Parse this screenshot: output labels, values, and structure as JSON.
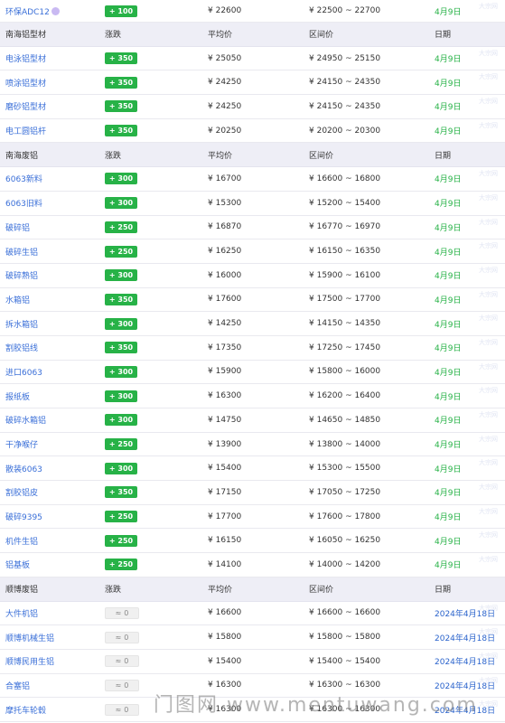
{
  "rows": [
    {
      "type": "item",
      "name": "环保ADC12",
      "tag": true,
      "change": "+ 100",
      "avg": "¥ 22600",
      "range": "¥ 22500 ~ 22700",
      "date": "4月9日",
      "date_color": "green",
      "first": true
    },
    {
      "type": "header",
      "name": "南海铝型材",
      "change": "涨跌",
      "avg": "平均价",
      "range": "区间价",
      "date": "日期"
    },
    {
      "type": "item",
      "name": "电泳铝型材",
      "change": "+ 350",
      "avg": "¥ 25050",
      "range": "¥ 24950 ~ 25150",
      "date": "4月9日",
      "date_color": "green"
    },
    {
      "type": "item",
      "name": "喷涂铝型材",
      "change": "+ 350",
      "avg": "¥ 24250",
      "range": "¥ 24150 ~ 24350",
      "date": "4月9日",
      "date_color": "green"
    },
    {
      "type": "item",
      "name": "磨砂铝型材",
      "change": "+ 350",
      "avg": "¥ 24250",
      "range": "¥ 24150 ~ 24350",
      "date": "4月9日",
      "date_color": "green"
    },
    {
      "type": "item",
      "name": "电工圆铝杆",
      "change": "+ 350",
      "avg": "¥ 20250",
      "range": "¥ 20200 ~ 20300",
      "date": "4月9日",
      "date_color": "green"
    },
    {
      "type": "header",
      "name": "南海废铝",
      "change": "涨跌",
      "avg": "平均价",
      "range": "区间价",
      "date": "日期"
    },
    {
      "type": "item",
      "name": "6063新料",
      "change": "+ 300",
      "avg": "¥ 16700",
      "range": "¥ 16600 ~ 16800",
      "date": "4月9日",
      "date_color": "green"
    },
    {
      "type": "item",
      "name": "6063旧料",
      "change": "+ 300",
      "avg": "¥ 15300",
      "range": "¥ 15200 ~ 15400",
      "date": "4月9日",
      "date_color": "green"
    },
    {
      "type": "item",
      "name": "破碎铝",
      "change": "+ 250",
      "avg": "¥ 16870",
      "range": "¥ 16770 ~ 16970",
      "date": "4月9日",
      "date_color": "green"
    },
    {
      "type": "item",
      "name": "破碎生铝",
      "change": "+ 250",
      "avg": "¥ 16250",
      "range": "¥ 16150 ~ 16350",
      "date": "4月9日",
      "date_color": "green"
    },
    {
      "type": "item",
      "name": "破碎熟铝",
      "change": "+ 300",
      "avg": "¥ 16000",
      "range": "¥ 15900 ~ 16100",
      "date": "4月9日",
      "date_color": "green"
    },
    {
      "type": "item",
      "name": "水箱铝",
      "change": "+ 350",
      "avg": "¥ 17600",
      "range": "¥ 17500 ~ 17700",
      "date": "4月9日",
      "date_color": "green"
    },
    {
      "type": "item",
      "name": "拆水箱铝",
      "change": "+ 300",
      "avg": "¥ 14250",
      "range": "¥ 14150 ~ 14350",
      "date": "4月9日",
      "date_color": "green"
    },
    {
      "type": "item",
      "name": "割胶铝线",
      "change": "+ 350",
      "avg": "¥ 17350",
      "range": "¥ 17250 ~ 17450",
      "date": "4月9日",
      "date_color": "green"
    },
    {
      "type": "item",
      "name": "进口6063",
      "change": "+ 300",
      "avg": "¥ 15900",
      "range": "¥ 15800 ~ 16000",
      "date": "4月9日",
      "date_color": "green"
    },
    {
      "type": "item",
      "name": "报纸板",
      "change": "+ 300",
      "avg": "¥ 16300",
      "range": "¥ 16200 ~ 16400",
      "date": "4月9日",
      "date_color": "green"
    },
    {
      "type": "item",
      "name": "破碎水箱铝",
      "change": "+ 300",
      "avg": "¥ 14750",
      "range": "¥ 14650 ~ 14850",
      "date": "4月9日",
      "date_color": "green"
    },
    {
      "type": "item",
      "name": "干净喉仔",
      "change": "+ 250",
      "avg": "¥ 13900",
      "range": "¥ 13800 ~ 14000",
      "date": "4月9日",
      "date_color": "green"
    },
    {
      "type": "item",
      "name": "散装6063",
      "change": "+ 300",
      "avg": "¥ 15400",
      "range": "¥ 15300 ~ 15500",
      "date": "4月9日",
      "date_color": "green"
    },
    {
      "type": "item",
      "name": "割胶铝皮",
      "change": "+ 350",
      "avg": "¥ 17150",
      "range": "¥ 17050 ~ 17250",
      "date": "4月9日",
      "date_color": "green"
    },
    {
      "type": "item",
      "name": "破碎9395",
      "change": "+ 250",
      "avg": "¥ 17700",
      "range": "¥ 17600 ~ 17800",
      "date": "4月9日",
      "date_color": "green"
    },
    {
      "type": "item",
      "name": "机件生铝",
      "change": "+ 250",
      "avg": "¥ 16150",
      "range": "¥ 16050 ~ 16250",
      "date": "4月9日",
      "date_color": "green"
    },
    {
      "type": "item",
      "name": "铝基板",
      "change": "+ 250",
      "avg": "¥ 14100",
      "range": "¥ 14000 ~ 14200",
      "date": "4月9日",
      "date_color": "green"
    },
    {
      "type": "header",
      "name": "顺博废铝",
      "change": "涨跌",
      "avg": "平均价",
      "range": "区间价",
      "date": "日期"
    },
    {
      "type": "item",
      "name": "大件机铝",
      "change": "0",
      "flat": true,
      "avg": "¥ 16600",
      "range": "¥ 16600 ~ 16600",
      "date": "2024年4月18日",
      "date_color": "blue"
    },
    {
      "type": "item",
      "name": "顺博机械生铝",
      "change": "0",
      "flat": true,
      "avg": "¥ 15800",
      "range": "¥ 15800 ~ 15800",
      "date": "2024年4月18日",
      "date_color": "blue"
    },
    {
      "type": "item",
      "name": "顺博民用生铝",
      "change": "0",
      "flat": true,
      "avg": "¥ 15400",
      "range": "¥ 15400 ~ 15400",
      "date": "2024年4月18日",
      "date_color": "blue"
    },
    {
      "type": "item",
      "name": "合塞铝",
      "change": "0",
      "flat": true,
      "avg": "¥ 16300",
      "range": "¥ 16300 ~ 16300",
      "date": "2024年4月18日",
      "date_color": "blue"
    },
    {
      "type": "item",
      "name": "摩托车轮毂",
      "change": "0",
      "flat": true,
      "avg": "¥ 16300",
      "range": "¥ 16300 ~ 16300",
      "date": "2024年4月18日",
      "date_color": "blue"
    }
  ],
  "watermark": "门图网 www.mentuwang.com",
  "row_watermark": "大宗网",
  "flat_prefix": "≈",
  "colors": {
    "green": "#27b247",
    "blue": "#2a63cc",
    "link": "#3a6fd8",
    "header_bg": "#eeeef6"
  }
}
